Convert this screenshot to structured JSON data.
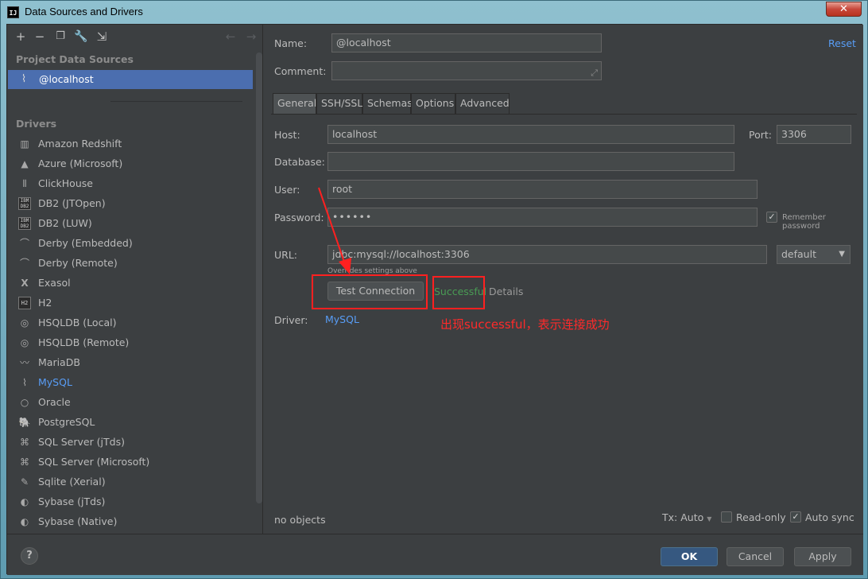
{
  "window": {
    "title": "Data Sources and Drivers",
    "app_icon_text": "IJ",
    "close_label": "✕"
  },
  "toolbar": {
    "icons": [
      "add-icon",
      "remove-icon",
      "duplicate-icon",
      "wrench-icon",
      "import-icon",
      "back-arrow-icon",
      "forward-arrow-icon"
    ]
  },
  "left": {
    "project_section_label": "Project Data Sources",
    "data_source": {
      "label": "@localhost",
      "icon": "mysql-icon"
    },
    "drivers_section_label": "Drivers",
    "drivers": [
      {
        "label": "Amazon Redshift",
        "icon": "redshift-icon"
      },
      {
        "label": "Azure (Microsoft)",
        "icon": "azure-icon"
      },
      {
        "label": "ClickHouse",
        "icon": "clickhouse-icon"
      },
      {
        "label": "DB2 (JTOpen)",
        "icon": "db2-icon"
      },
      {
        "label": "DB2 (LUW)",
        "icon": "db2-icon"
      },
      {
        "label": "Derby (Embedded)",
        "icon": "derby-icon"
      },
      {
        "label": "Derby (Remote)",
        "icon": "derby-icon"
      },
      {
        "label": "Exasol",
        "icon": "exasol-icon"
      },
      {
        "label": "H2",
        "icon": "h2-icon"
      },
      {
        "label": "HSQLDB (Local)",
        "icon": "hsqldb-icon"
      },
      {
        "label": "HSQLDB (Remote)",
        "icon": "hsqldb-icon"
      },
      {
        "label": "MariaDB",
        "icon": "mariadb-icon"
      },
      {
        "label": "MySQL",
        "icon": "mysql-icon"
      },
      {
        "label": "Oracle",
        "icon": "oracle-icon"
      },
      {
        "label": "PostgreSQL",
        "icon": "postgresql-icon"
      },
      {
        "label": "SQL Server (jTds)",
        "icon": "sqlserver-icon"
      },
      {
        "label": "SQL Server (Microsoft)",
        "icon": "sqlserver-icon"
      },
      {
        "label": "Sqlite (Xerial)",
        "icon": "sqlite-icon"
      },
      {
        "label": "Sybase (jTds)",
        "icon": "sybase-icon"
      },
      {
        "label": "Sybase (Native)",
        "icon": "sybase-icon"
      }
    ]
  },
  "form": {
    "name_label": "Name:",
    "name_value": "@localhost",
    "comment_label": "Comment:",
    "comment_value": "",
    "reset_label": "Reset",
    "tabs": [
      "General",
      "SSH/SSL",
      "Schemas",
      "Options",
      "Advanced"
    ],
    "host_label": "Host:",
    "host_value": "localhost",
    "port_label": "Port:",
    "port_value": "3306",
    "database_label": "Database:",
    "database_value": "",
    "user_label": "User:",
    "user_value": "root",
    "password_label": "Password:",
    "password_value": "••••••",
    "remember_password_label": "Remember password",
    "url_label": "URL:",
    "url_value": "jdbc:mysql://localhost:3306",
    "url_hint": "Overrides settings above",
    "url_mode": "default",
    "test_connection_label": "Test Connection",
    "test_status": "Successful",
    "details_label": "Details",
    "driver_label": "Driver:",
    "driver_value": "MySQL"
  },
  "annotation": {
    "text": "出现successful，表示连接成功",
    "color": "#ff2020"
  },
  "status": {
    "objects_text": "no objects",
    "tx_label": "Tx: Auto",
    "readonly_label": "Read-only",
    "readonly_checked": false,
    "autosync_label": "Auto sync",
    "autosync_checked": true
  },
  "footer": {
    "help_label": "?",
    "ok_label": "OK",
    "cancel_label": "Cancel",
    "apply_label": "Apply"
  },
  "colors": {
    "selection": "#4b6eaf",
    "link": "#589df6",
    "success": "#499c54",
    "background": "#3c3f41"
  }
}
